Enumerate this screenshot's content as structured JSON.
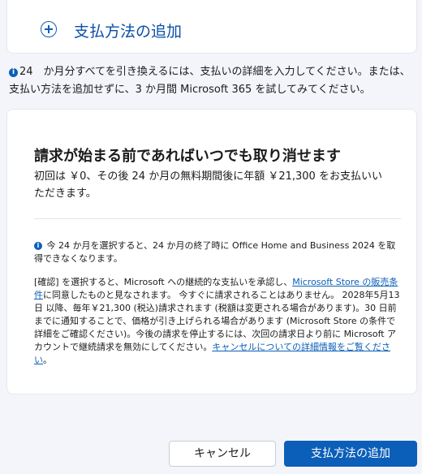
{
  "add_payment": {
    "label": "支払方法の追加",
    "icon": "plus-circle-icon"
  },
  "info": {
    "text": "24　か月分すべてを引き換えるには、支払いの詳細を入力してください。または、支払い方法を追加せずに、3 か月間 Microsoft 365 を試してみてください。"
  },
  "summary": {
    "title": "請求が始まる前であればいつでも取り消せます",
    "subtitle": "初回は ￥0、その後 24 か月の無料期間後に年額 ￥21,300 をお支払いいただきます。"
  },
  "notice": {
    "text": "今 24 か月を選択すると、24 か月の終了時に Office Home and Business 2024 を取得できなくなります。"
  },
  "legal": {
    "part1": "[確認] を選択すると、Microsoft への継続的な支払いを承認し、",
    "link1": "Microsoft Store の販売条件",
    "part2": "に同意したものと見なされます。 今すぐに請求されることはありません。 2028年5月13日 以降、毎年￥21,300 (税込)請求されます (税額は変更される場合があります)。30 日前までに通知することで、価格が引き上げられる場合があります (Microsoft Store の条件で詳細をご確認ください)。今後の請求を停止するには、次回の請求日より前に Microsoft アカウントで継続請求を無効にしてください。",
    "link2": "キャンセルについての詳細情報をご覧ください",
    "part3": "。"
  },
  "buttons": {
    "cancel": "キャンセル",
    "add": "支払方法の追加"
  },
  "colors": {
    "accent": "#0b5fb8",
    "link": "#0b4fa8",
    "background": "#f3f5fa"
  }
}
